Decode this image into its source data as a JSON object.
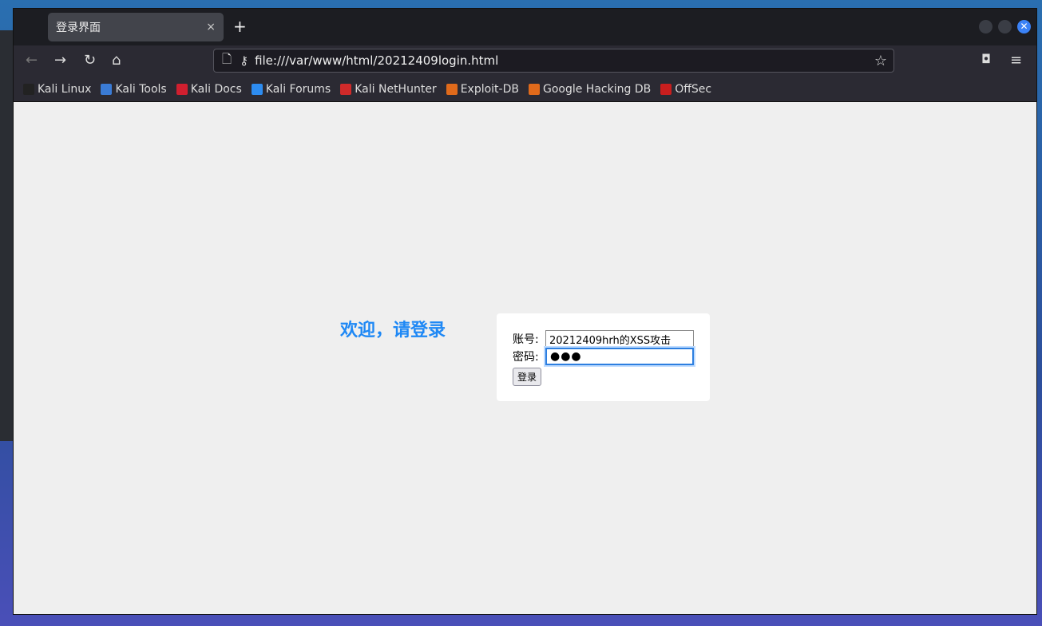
{
  "browser": {
    "tab_title": "登录界面",
    "new_tab": "+",
    "close_tab": "×",
    "url": "file:///var/www/html/20212409login.html"
  },
  "bookmarks": [
    {
      "label": "Kali Linux",
      "color": "#222222"
    },
    {
      "label": "Kali Tools",
      "color": "#3a7bd5"
    },
    {
      "label": "Kali Docs",
      "color": "#d01f2f"
    },
    {
      "label": "Kali Forums",
      "color": "#2d8cf0"
    },
    {
      "label": "Kali NetHunter",
      "color": "#d02a2a"
    },
    {
      "label": "Exploit-DB",
      "color": "#e06a1b"
    },
    {
      "label": "Google Hacking DB",
      "color": "#e06a1b"
    },
    {
      "label": "OffSec",
      "color": "#c81e1e"
    }
  ],
  "page": {
    "welcome": "欢迎，请登录",
    "account_label": "账号:",
    "account_value": "20212409hrh的XSS攻击",
    "password_label": "密码:",
    "password_value": "●●●",
    "login_button": "登录"
  }
}
